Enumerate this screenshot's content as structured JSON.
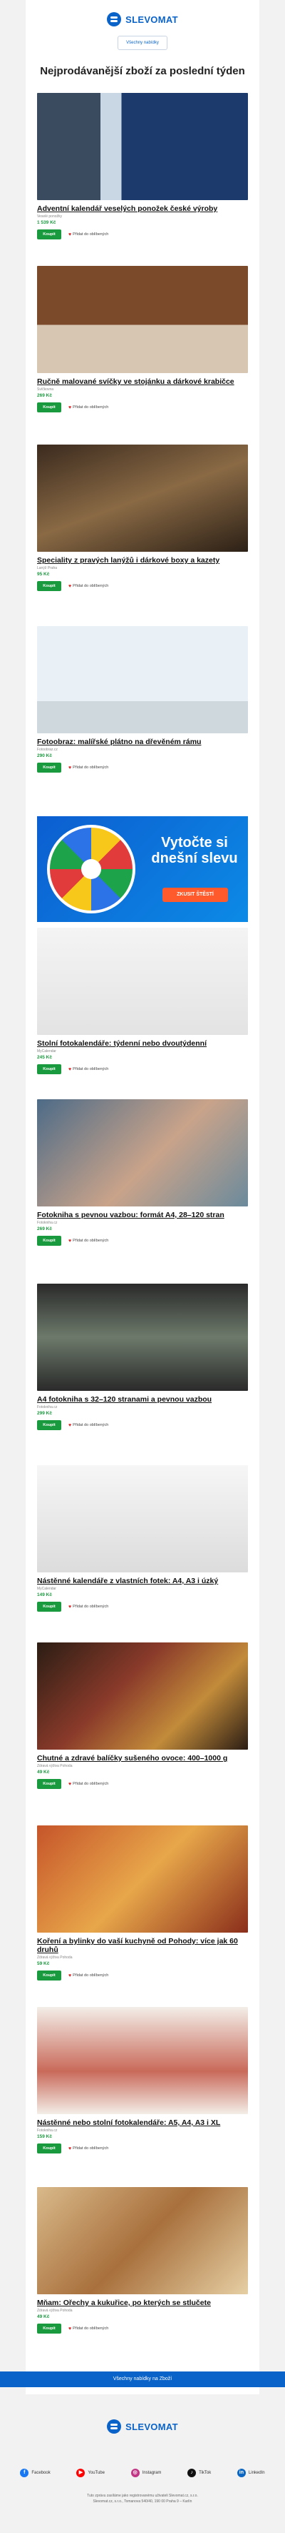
{
  "brand": "SLEVOMAT",
  "top_button": "Všechny nabídky",
  "heading": "Nejprodávanější zboží za poslední týden",
  "buy_label": "Koupit",
  "fav_label": "Přidat do oblíbených",
  "items": [
    {
      "title": "Adventní kalendář veselých ponožek české výroby",
      "seller": "Veselé ponožky",
      "price": "1 539 Kč",
      "img": "socks"
    },
    {
      "title": "Ručně malované svíčky ve stojánku a dárkové krabičce",
      "seller": "Svíčkovna",
      "price": "269 Kč",
      "img": "candles"
    },
    {
      "title": "Speciality z pravých lanýžů i dárkové boxy a kazety",
      "seller": "Lanýž Praha",
      "price": "95 Kč",
      "img": "truffle"
    },
    {
      "title": "Fotoobraz: malířské plátno na dřevěném rámu",
      "seller": "Fotoobraz.cz",
      "price": "290 Kč",
      "img": "canvas"
    },
    {
      "title": "Stolní fotokalendáře: týdenní nebo dvoutýdenní",
      "seller": "MyCalendar",
      "price": "245 Kč",
      "img": "deskcal"
    },
    {
      "title": "Fotokniha s pevnou vazbou: formát A4, 28–120 stran",
      "seller": "Fotokniha.cz",
      "price": "269 Kč",
      "img": "photobook"
    },
    {
      "title": "A4 fotokniha s 32–120 stranami a pevnou vazbou",
      "seller": "Fotokniha.cz",
      "price": "299 Kč",
      "img": "photobook2"
    },
    {
      "title": "Nástěnné kalendáře z vlastních fotek: A4, A3 i úzký",
      "seller": "MyCalendar",
      "price": "149 Kč",
      "img": "wallcal"
    },
    {
      "title": "Chutné a zdravé balíčky sušeného ovoce: 400–1000 g",
      "seller": "Zdravá výživa Pohoda",
      "price": "49 Kč",
      "img": "dried"
    },
    {
      "title": "Koření a bylinky do vaší kuchyně od Pohody: více jak 60 druhů",
      "seller": "Zdravá výživa Pohoda",
      "price": "59 Kč",
      "img": "spices"
    },
    {
      "title": "Nástěnné nebo stolní fotokalendáře: A5, A4, A3 i XL",
      "seller": "Fotokniha.cz",
      "price": "159 Kč",
      "img": "cal2"
    },
    {
      "title": "Mňam: Ořechy a kukuřice, po kterých se stlučete",
      "seller": "Zdravá výživa Pohoda",
      "price": "49 Kč",
      "img": "nuts"
    }
  ],
  "banner": {
    "text": "Vytočte si dnešní slevu",
    "button": "ZKUSIT ŠTĚSTÍ"
  },
  "bottom_button": "Všechny nabídky na Zboží",
  "social": [
    {
      "name": "Facebook",
      "icon": "facebook-icon",
      "color": "#1877f2",
      "glyph": "f"
    },
    {
      "name": "YouTube",
      "icon": "youtube-icon",
      "color": "#ff0000",
      "glyph": "▶"
    },
    {
      "name": "Instagram",
      "icon": "instagram-icon",
      "color": "#c13584",
      "glyph": "◎"
    },
    {
      "name": "TikTok",
      "icon": "tiktok-icon",
      "color": "#111111",
      "glyph": "♪"
    },
    {
      "name": "LinkedIn",
      "icon": "linkedin-icon",
      "color": "#0a66c2",
      "glyph": "in"
    }
  ],
  "footer_text": "Tuto zprávu zasíláme jako registrovanému uživateli Slevomat.cz, s.r.o.",
  "footer_address": "Slevomat.cz, s.r.o., Tomanova 540/40, 190 00 Praha 9 – Karlín"
}
